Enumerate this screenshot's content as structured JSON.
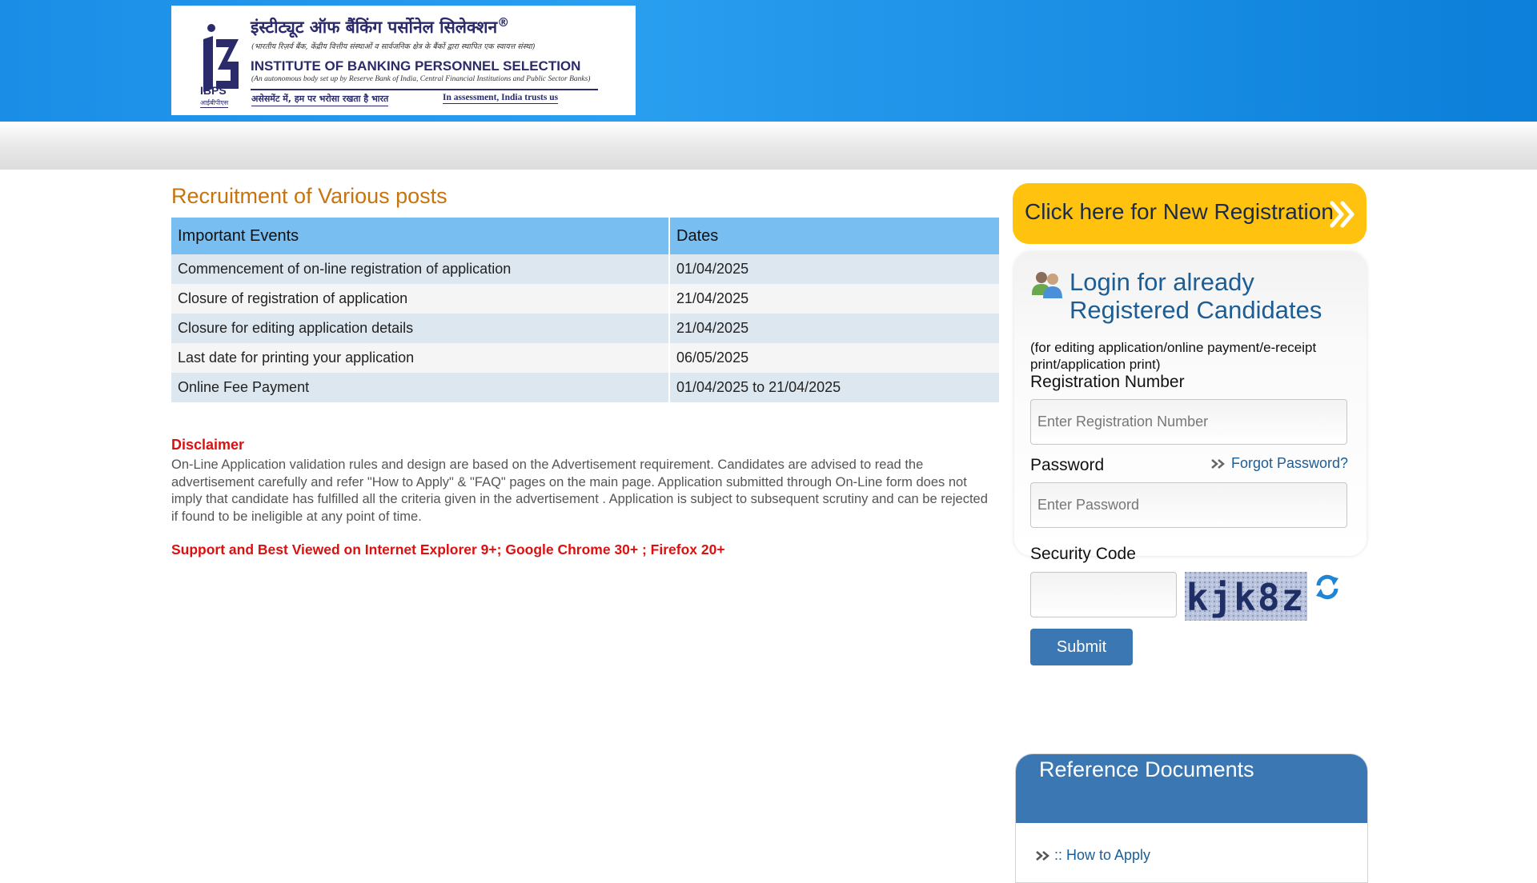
{
  "header": {
    "logo": {
      "hindi_title": "इंस्टीट्यूट ऑफ बैंकिंग पर्सोनेल सिलेक्शन",
      "registered_mark": "®",
      "hindi_sub": "(भारतीय रिज़र्व बैंक, केंद्रीय वित्तीय संस्थाओं व सार्वजनिक क्षेत्र के बैंकों द्वारा स्थापित एक स्वायत्त संस्था)",
      "english_title": "INSTITUTE OF BANKING PERSONNEL SELECTION",
      "english_sub": "(An autonomous body set up by Reserve Bank of India, Central Financial Institutions and Public Sector Banks)",
      "tagline_hindi": "असेसमेंट में, हम पर भरोसा रखता है भारत",
      "tagline_english": "In assessment, India trusts us",
      "ibps": "IBPS",
      "ibps_hindi": "आईबीपीएस"
    }
  },
  "main": {
    "title": "Recruitment of Various posts",
    "table": {
      "headers": [
        "Important Events",
        "Dates"
      ],
      "rows": [
        {
          "event": "Commencement of on-line registration of application",
          "date": "01/04/2025"
        },
        {
          "event": "Closure of registration of application",
          "date": "21/04/2025"
        },
        {
          "event": "Closure for editing application details",
          "date": "21/04/2025"
        },
        {
          "event": "Last date for printing your application",
          "date": "06/05/2025"
        },
        {
          "event": "Online Fee Payment",
          "date": "01/04/2025 to 21/04/2025"
        }
      ]
    },
    "disclaimer_title": "Disclaimer",
    "disclaimer_text": "On-Line Application validation rules and design are based on the Advertisement requirement. Candidates are advised to read the advertisement carefully and refer \"How to Apply\" & \"FAQ\" pages on the main page. Application submitted through On-Line form does not imply that candidate has fulfilled all the criteria given in the advertisement . Application is subject to subsequent scrutiny and can be rejected if found to be ineligible at any point of time.",
    "support_text": "Support and Best Viewed on Internet Explorer 9+; Google Chrome 30+ ; Firefox 20+"
  },
  "sidebar": {
    "new_registration": "Click here for New Registration",
    "login": {
      "title": "Login for already Registered Candidates",
      "note": "(for editing application/online payment/e-receipt print/application print)",
      "registration_label": "Registration Number",
      "registration_placeholder": "Enter Registration Number",
      "password_label": "Password",
      "password_placeholder": "Enter Password",
      "forgot_password": "Forgot Password?",
      "security_label": "Security Code",
      "security_value": "",
      "captcha_text": "kjk8z",
      "submit": "Submit"
    },
    "reference": {
      "title": "Reference Documents",
      "links": [
        ":: How to Apply"
      ]
    }
  },
  "colors": {
    "header_blue": "#1a8ee6",
    "title_orange": "#c8740e",
    "table_header": "#79bef0",
    "alert_red": "#dd1010",
    "registration_yellow": "#ffc20e",
    "login_blue": "#1c5d95",
    "button_blue": "#3b77b3"
  },
  "icons": {
    "new_registration_arrow": "double-chevron-right-icon",
    "login": "users-icon",
    "forgot": "double-chevron-right-icon",
    "refresh": "refresh-icon",
    "reference_link": "double-chevron-right-icon"
  }
}
